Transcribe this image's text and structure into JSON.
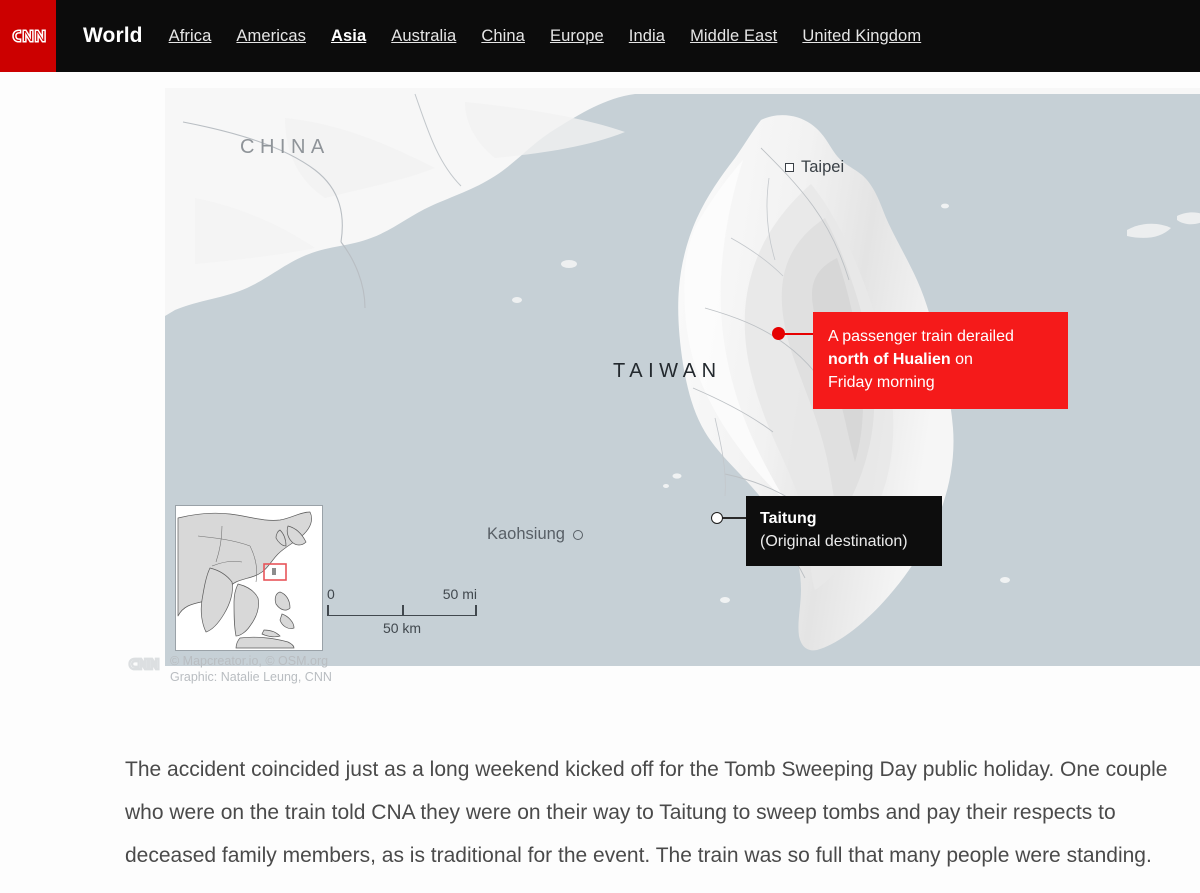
{
  "nav": {
    "logo_alt": "CNN",
    "section": "World",
    "items": [
      {
        "label": "Africa",
        "active": false
      },
      {
        "label": "Americas",
        "active": false
      },
      {
        "label": "Asia",
        "active": true
      },
      {
        "label": "Australia",
        "active": false
      },
      {
        "label": "China",
        "active": false
      },
      {
        "label": "Europe",
        "active": false
      },
      {
        "label": "India",
        "active": false
      },
      {
        "label": "Middle East",
        "active": false
      },
      {
        "label": "United Kingdom",
        "active": false
      }
    ]
  },
  "map": {
    "labels": {
      "china": "CHINA",
      "taiwan": "TAIWAN",
      "taipei": "Taipei",
      "kaohsiung": "Kaohsiung"
    },
    "callout_red": {
      "line1": "A passenger train derailed",
      "bold": "north of Hualien",
      "line2_tail": " on",
      "line3": "Friday morning",
      "color": "#f51a1a"
    },
    "callout_black": {
      "title": "Taitung",
      "subtitle": "(Original destination)",
      "color": "#0d0d0d"
    },
    "scale": {
      "zero": "0",
      "miles": "50 mi",
      "km": "50 km"
    },
    "colors": {
      "water": "#c6d0d6",
      "land": "#f7f7f7",
      "accent_red": "#e60000",
      "brand_red": "#cc0000"
    }
  },
  "attribution": {
    "logo_alt": "CNN",
    "line1": "© Mapcreator.io, © OSM.org",
    "line2": "Graphic: Natalie Leung, CNN"
  },
  "article": {
    "paragraph": "The accident coincided just as a long weekend kicked off for the Tomb Sweeping Day public holiday. One couple who were on the train told CNA they were on their way to Taitung to sweep tombs and pay their respects to deceased family members, as is traditional for the event. The train was so full that many people were standing."
  }
}
